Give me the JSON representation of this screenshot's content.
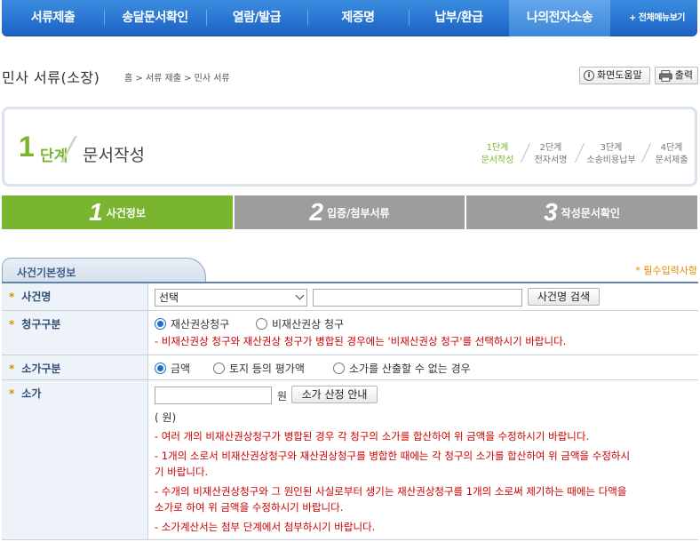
{
  "nav": {
    "items": [
      "서류제출",
      "송달문서확인",
      "열람/발급",
      "제증명",
      "납부/환급",
      "나의전자소송"
    ],
    "all_menu": "+ 전체메뉴보기"
  },
  "header": {
    "title": "민사 서류(소장)",
    "breadcrumb": "홈 > 서류 제출 > 민사 서류",
    "help_label": "화면도움말",
    "print_label": "출력"
  },
  "step": {
    "number": "1",
    "unit": "단계",
    "name": "문서작성",
    "mini_steps": [
      {
        "line1": "1단계",
        "line2": "문서작성"
      },
      {
        "line1": "2단계",
        "line2": "전자서명"
      },
      {
        "line1": "3단계",
        "line2": "소송비용납부"
      },
      {
        "line1": "4단계",
        "line2": "문서제출"
      }
    ]
  },
  "tabs": [
    {
      "num": "1",
      "label": "사건정보"
    },
    {
      "num": "2",
      "label": "입증/첨부서류"
    },
    {
      "num": "3",
      "label": "작성문서확인"
    }
  ],
  "section": {
    "title": "사건기본정보",
    "required_note": "* 필수입력사항"
  },
  "form": {
    "case_name": {
      "label": "사건명",
      "select_value": "선택",
      "search_button": "사건명 검색"
    },
    "claim_type": {
      "label": "청구구분",
      "options": [
        "재산권상청구",
        "비재산권상 청구"
      ],
      "note": "- 비재산권상 청구와 재산권상 청구가 병합된 경우에는 '비재산권상 청구'를 선택하시기 바랍니다."
    },
    "value_type": {
      "label": "소가구분",
      "options": [
        "금액",
        "토지 등의 평가액",
        "소가를 산출할 수 없는 경우"
      ]
    },
    "value": {
      "label": "소가",
      "unit": "원",
      "guide_button": "소가 산정 안내",
      "amount_text": "( 원)",
      "notes": [
        "- 여러 개의 비재산권상청구가 병합된 경우 각 청구의 소가를 합산하여 위 금액을 수정하시기 바랍니다.",
        "- 1개의 소로서 비재산권상청구와 재산권상청구를 병합한 때에는 각 청구의 소가를 합산하여 위 금액을 수정하시",
        "기 바랍니다.",
        "- 수개의 비재산권상청구와 그 원인된 사실로부터 생기는 재산권상청구를 1개의 소로써 제기하는 때에는 다액을",
        "소가로 하여 위 금액을 수정하시기 바랍니다.",
        "- 소가계산서는 첨부 단계에서 첨부하시기 바랍니다."
      ]
    }
  }
}
